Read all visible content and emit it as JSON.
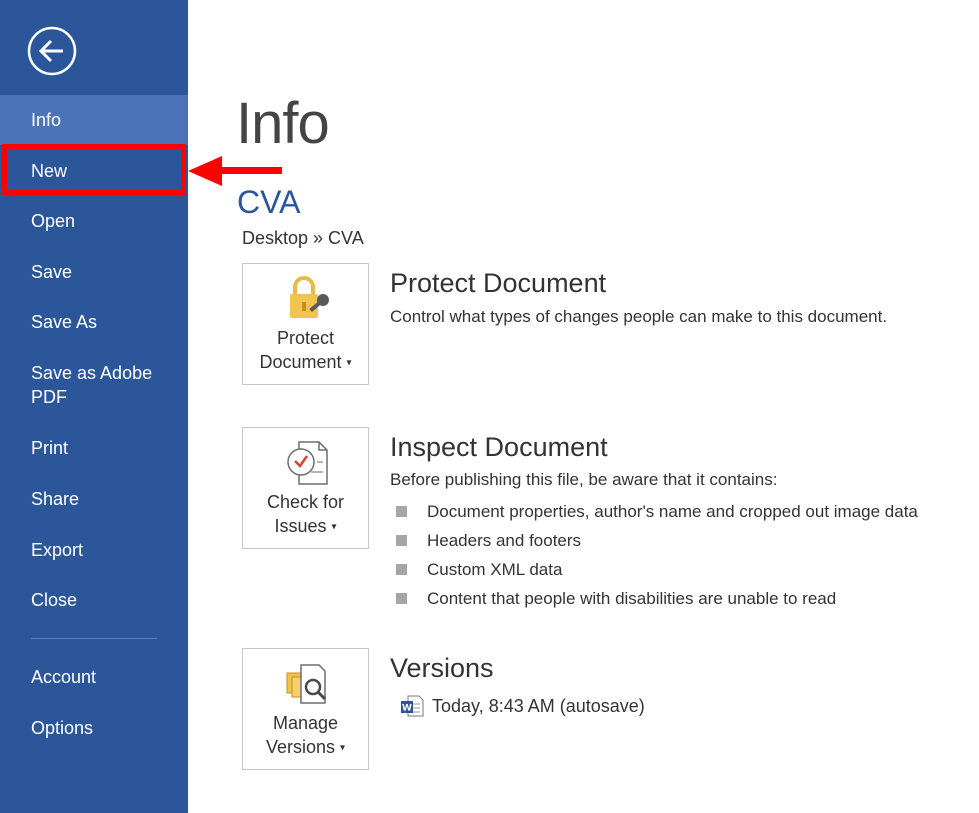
{
  "sidebar": {
    "items": [
      {
        "label": "Info"
      },
      {
        "label": "New"
      },
      {
        "label": "Open"
      },
      {
        "label": "Save"
      },
      {
        "label": "Save As"
      },
      {
        "label": "Save as Adobe PDF"
      },
      {
        "label": "Print"
      },
      {
        "label": "Share"
      },
      {
        "label": "Export"
      },
      {
        "label": "Close"
      },
      {
        "label": "Account"
      },
      {
        "label": "Options"
      }
    ],
    "selected": "Info",
    "back_icon": "back-arrow-circle-icon"
  },
  "main": {
    "title": "Info",
    "doc_name": "CVA",
    "doc_path": "Desktop » CVA",
    "protect": {
      "button_line1": "Protect",
      "button_line2": "Document",
      "title": "Protect Document",
      "description": "Control what types of changes people can make to this document."
    },
    "inspect": {
      "button_line1": "Check for",
      "button_line2": "Issues",
      "title": "Inspect Document",
      "description": "Before publishing this file, be aware that it contains:",
      "bullets": [
        "Document properties, author's name and cropped out image data",
        "Headers and footers",
        "Custom XML data",
        "Content that people with disabilities are unable to read"
      ]
    },
    "versions": {
      "button_line1": "Manage",
      "button_line2": "Versions",
      "title": "Versions",
      "entry": "Today, 8:43 AM (autosave)"
    }
  },
  "colors": {
    "sidebar_bg": "#2b579a",
    "selected_bg": "#4a73b8",
    "accent": "#2b579a",
    "annotation": "#ff0000"
  }
}
